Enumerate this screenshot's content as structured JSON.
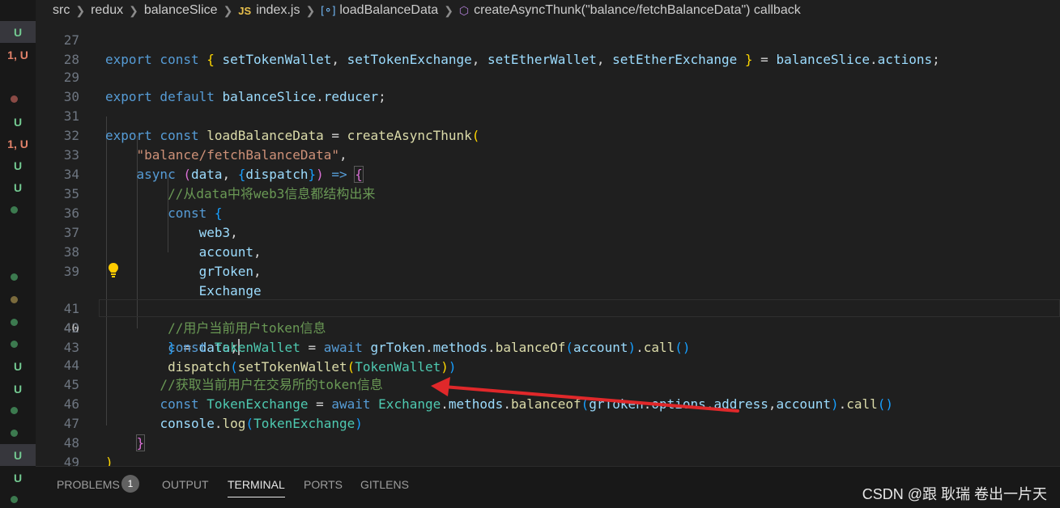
{
  "breadcrumb": {
    "items": [
      "src",
      "redux",
      "balanceSlice",
      "index.js",
      "loadBalanceData",
      "createAsyncThunk(\"balance/fetchBalanceData\") callback"
    ],
    "js_badge": "JS"
  },
  "gutter": {
    "marks": [
      {
        "text": "U",
        "color": "#73c991"
      },
      {
        "text": "1, U",
        "color": "#e2826a"
      },
      {
        "text": "U",
        "color": "#73c991"
      },
      {
        "text": "1, U",
        "color": "#e2826a"
      },
      {
        "text": "U",
        "color": "#73c991"
      },
      {
        "text": "U",
        "color": "#73c991"
      },
      {
        "text": "U",
        "color": "#73c991"
      },
      {
        "text": "U",
        "color": "#73c991"
      },
      {
        "text": "U",
        "color": "#73c991"
      },
      {
        "text": "U",
        "color": "#73c991"
      }
    ]
  },
  "editor": {
    "current_line": "40",
    "lines": [
      {
        "n": "27",
        "t": "export const { setTokenWallet, setTokenExchange, setEtherWallet, setEtherExchange } = balanceSlice.actions;"
      },
      {
        "n": "28",
        "t": ""
      },
      {
        "n": "29",
        "t": "export default balanceSlice.reducer;"
      },
      {
        "n": "30",
        "t": ""
      },
      {
        "n": "31",
        "t": "export const loadBalanceData = createAsyncThunk("
      },
      {
        "n": "32",
        "t": "    \"balance/fetchBalanceData\","
      },
      {
        "n": "33",
        "t": "    async (data, {dispatch}) => {"
      },
      {
        "n": "34",
        "t": "        //从data中将web3信息都结构出来"
      },
      {
        "n": "35",
        "t": "        const {"
      },
      {
        "n": "36",
        "t": "            web3,"
      },
      {
        "n": "37",
        "t": "            account,"
      },
      {
        "n": "38",
        "t": "            grToken,"
      },
      {
        "n": "39",
        "t": "            Exchange"
      },
      {
        "n": "40",
        "t": "        } = data;"
      },
      {
        "n": "41",
        "t": "        //用户当前用户token信息"
      },
      {
        "n": "42",
        "t": "        const TokenWallet = await grToken.methods.balanceOf(account).call()"
      },
      {
        "n": "43",
        "t": "        dispatch(setTokenWallet(TokenWallet))"
      },
      {
        "n": "44",
        "t": "       //获取当前用户在交易所的token信息"
      },
      {
        "n": "45",
        "t": "       const TokenExchange = await Exchange.methods.balanceof(grToken.options.address,account).call()"
      },
      {
        "n": "46",
        "t": "       console.log(TokenExchange)"
      },
      {
        "n": "47",
        "t": "    }"
      },
      {
        "n": "48",
        "t": ")"
      },
      {
        "n": "49",
        "t": ""
      }
    ]
  },
  "panel": {
    "tabs": [
      "PROBLEMS",
      "OUTPUT",
      "TERMINAL",
      "PORTS",
      "GITLENS"
    ],
    "active_tab": "TERMINAL",
    "problems_count": "1"
  },
  "watermark": "CSDN @跟 耿瑞 卷出一片天",
  "colors": {
    "background": "#1f1f1f",
    "keyword": "#569cd6",
    "function": "#dcdcaa",
    "variable": "#9cdcfe",
    "string": "#ce9178",
    "comment": "#6a9955",
    "arrow": "#e0282a"
  },
  "icons": [
    "chevron-right-icon",
    "symbol-variable-icon",
    "cube-icon",
    "lightbulb-icon",
    "red-arrow-annotation"
  ]
}
